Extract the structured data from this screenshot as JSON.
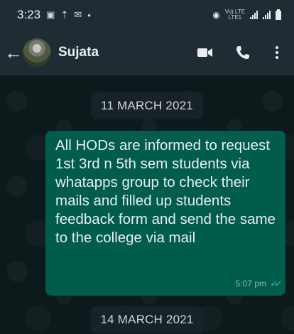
{
  "status_bar": {
    "time": "3:23",
    "network_label": "Vo) LTE",
    "network_sub": "LTE1"
  },
  "header": {
    "contact_name": "Sujata"
  },
  "chat": {
    "date_separators": [
      "11 MARCH 2021",
      "14 MARCH 2021"
    ],
    "messages": [
      {
        "text": "All HODs are informed to request 1st 3rd n 5th sem students via whatapps group to check their mails and filled up students feedback form and send the same to the college via mail",
        "time": "5:07 pm",
        "ticks": "✓✓"
      }
    ]
  },
  "colors": {
    "bar_bg": "#1f2c33",
    "chat_bg": "#0d1a1c",
    "bubble_out": "#005c4b",
    "date_chip": "#182229",
    "read_tick": "#53bdeb"
  },
  "icons": [
    "gallery-icon",
    "upload-icon",
    "gmail-icon",
    "hotspot-icon",
    "signal-icon",
    "battery-icon",
    "back-arrow-icon",
    "video-call-icon",
    "voice-call-icon",
    "more-options-icon"
  ]
}
